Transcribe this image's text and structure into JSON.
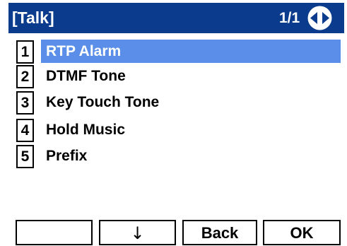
{
  "title_bar": {
    "title": "[Talk]",
    "page_indicator": "1/1",
    "nav_icon": "left-right-navigation-icon",
    "background_color": "#0b3b8c",
    "text_color": "#ffffff"
  },
  "menu": {
    "selected_index": 0,
    "highlight_color": "#5a8ee8",
    "items": [
      {
        "number": "1",
        "label": "RTP Alarm"
      },
      {
        "number": "2",
        "label": "DTMF Tone"
      },
      {
        "number": "3",
        "label": "Key Touch Tone"
      },
      {
        "number": "4",
        "label": "Hold Music"
      },
      {
        "number": "5",
        "label": "Prefix"
      }
    ]
  },
  "softkeys": {
    "key1": "",
    "key2": "↓",
    "key2_icon": "down-arrow-icon",
    "key3": "Back",
    "key4": "OK"
  }
}
